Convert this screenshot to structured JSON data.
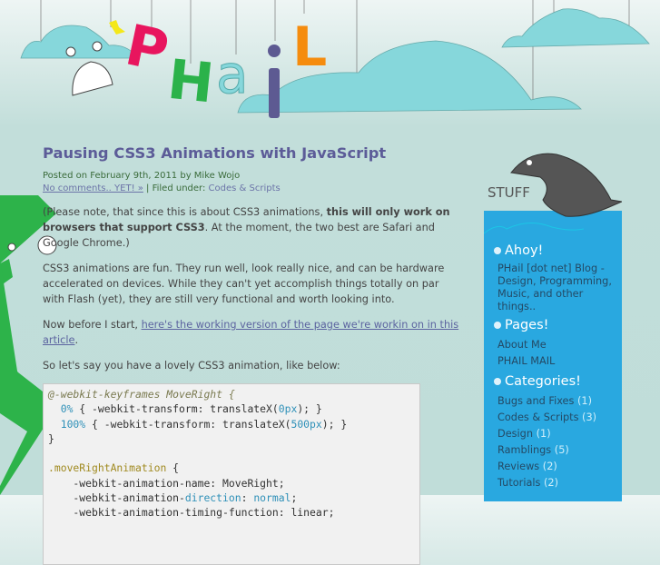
{
  "header": {
    "logo_text": "PHaiL"
  },
  "post": {
    "title": "Pausing CSS3 Animations with JavaScript",
    "posted_prefix": "Posted on ",
    "date": "February 9th, 2011",
    "by": " by ",
    "author": "Mike Wojo",
    "comments_link": "No comments.. YET! »",
    "filed_under": " | Filed under: ",
    "category": "Codes & Scripts",
    "p1_a": "(Please note, that since this is about CSS3 animations, ",
    "p1_bold": "this will only work on browsers that support CSS3",
    "p1_b": ". At the moment, the two best are Safari and Google Chrome.)",
    "p2": "CSS3 animations are fun. They run well, look really nice, and can be hardware accelerated on devices. While they can't yet accomplish things totally on par with Flash (yet), they are still very functional and worth looking into.",
    "p3_a": "Now before I start, ",
    "p3_link": "here's the working version of the page we're workin on in this article",
    "p3_b": ".",
    "p4": "So let's say you have a lovely CSS3 animation, like below:",
    "code": {
      "l1": "@-webkit-keyframes MoveRight {",
      "l2a": "  ",
      "l2n": "0%",
      "l2b": " { -webkit-transform: translateX(",
      "l2v": "0px",
      "l2c": "); }",
      "l3a": "  ",
      "l3n": "100%",
      "l3b": " { -webkit-transform: translateX(",
      "l3v": "500px",
      "l3c": "); }",
      "l4": "}",
      "l6": ".moveRightAnimation",
      " l6b": " {",
      "l6brace": " {",
      "l7": "    -webkit-animation-name: MoveRight;",
      "l8a": "    -webkit-animation-",
      "l8k": "direction",
      "l8b": ": ",
      "l8v": "normal",
      "l8c": ";",
      "l9": "    -webkit-animation-timing-function: linear;"
    }
  },
  "sidebar": {
    "header_label": "STUFF",
    "ahoy": {
      "title": "Ahoy!",
      "text": "PHail [dot net] Blog - Design, Programming, Music, and other things.."
    },
    "pages": {
      "title": "Pages!",
      "items": [
        "About Me",
        "PHAIL MAIL"
      ]
    },
    "categories": {
      "title": "Categories!",
      "items": [
        {
          "name": "Bugs and Fixes",
          "count": "(1)"
        },
        {
          "name": "Codes & Scripts",
          "count": "(3)"
        },
        {
          "name": "Design",
          "count": "(1)"
        },
        {
          "name": "Ramblings",
          "count": "(5)"
        },
        {
          "name": "Reviews",
          "count": "(2)"
        },
        {
          "name": "Tutorials",
          "count": "(2)"
        }
      ]
    }
  }
}
